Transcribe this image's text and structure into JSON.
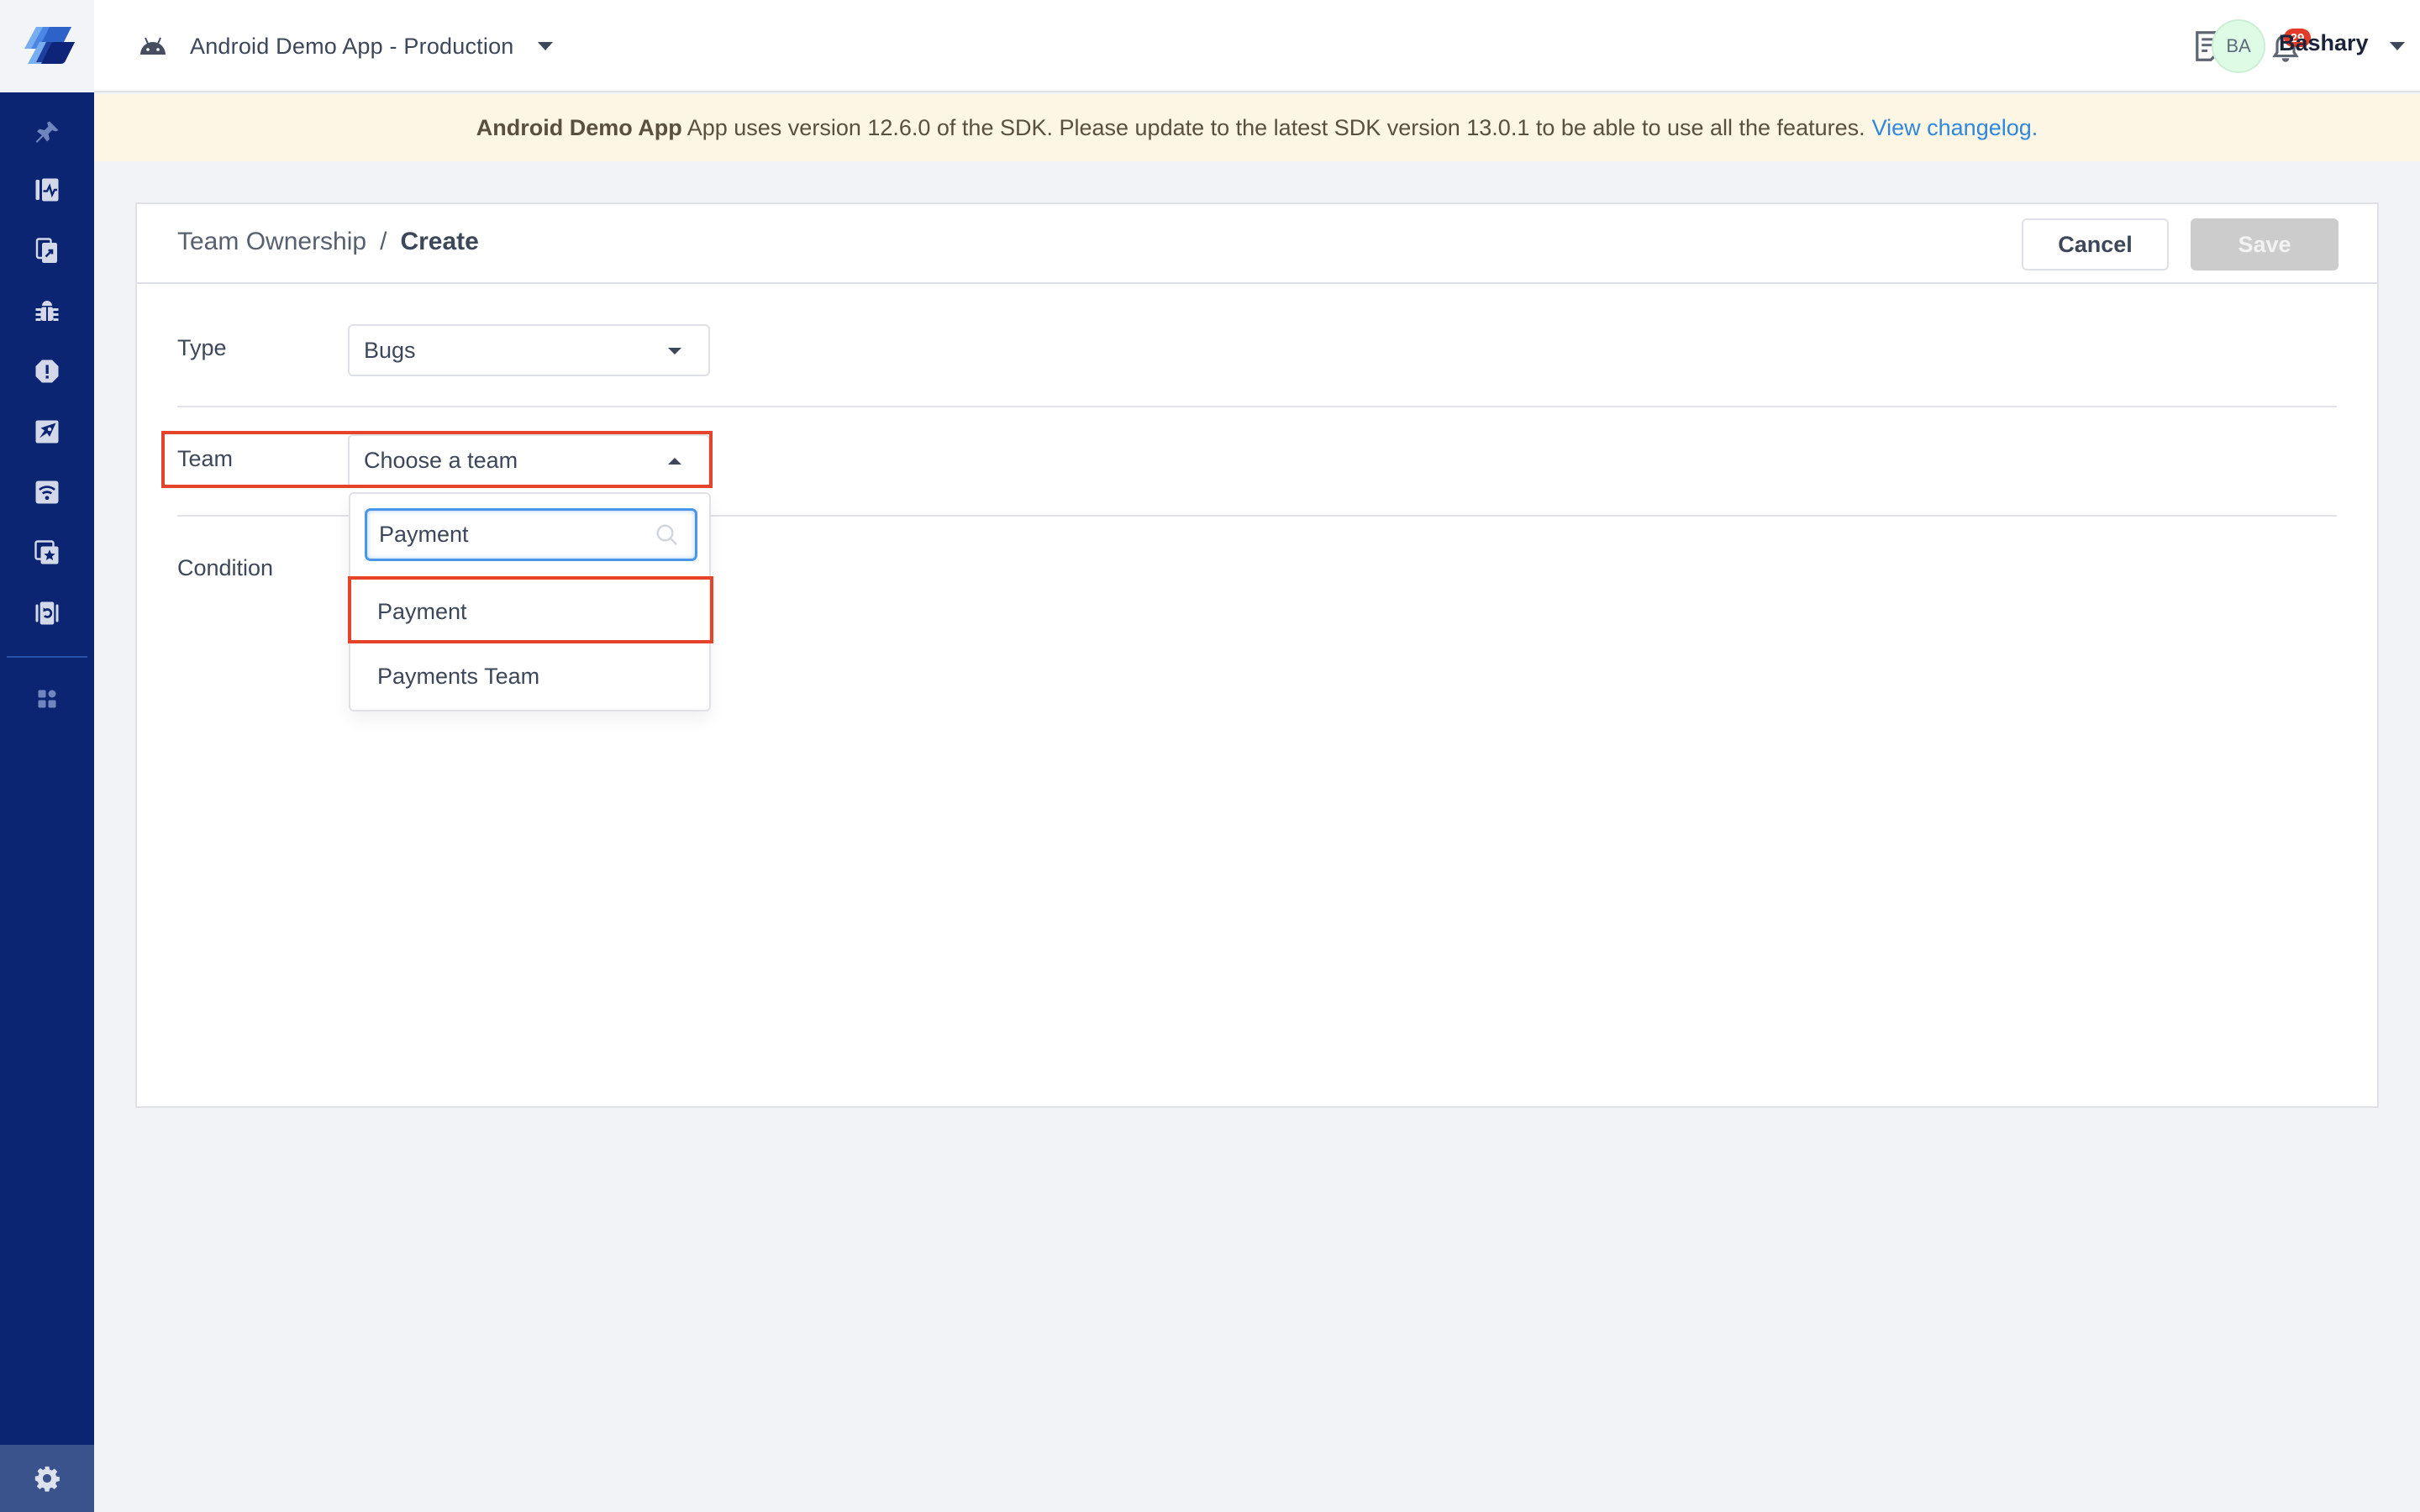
{
  "sidebar": {
    "logo": "instabug-logo-icon",
    "items": [
      {
        "name": "pin",
        "icon": "pin-icon"
      },
      {
        "name": "app-performance",
        "icon": "app-performance-icon"
      },
      {
        "name": "app-insights",
        "icon": "app-insights-icon"
      },
      {
        "name": "bugs",
        "icon": "bug-icon"
      },
      {
        "name": "crashes",
        "icon": "crash-icon"
      },
      {
        "name": "releases",
        "icon": "rocket-icon"
      },
      {
        "name": "network",
        "icon": "wifi-icon"
      },
      {
        "name": "ratings",
        "icon": "star-icon"
      },
      {
        "name": "replays",
        "icon": "replay-icon"
      },
      {
        "name": "apps",
        "icon": "apps-grid-icon"
      }
    ],
    "settings_icon": "gear-icon"
  },
  "topbar": {
    "app_name": "Android Demo App - Production",
    "platform_icon": "android-icon",
    "notifications_count": "29",
    "user_initials": "BA",
    "user_name": "Bashary"
  },
  "banner": {
    "app_bold": "Android Demo App",
    "message": " App uses version 12.6.0 of the SDK. Please update to the latest SDK version 13.0.1 to be able to use all the features.",
    "link_text": "View changelog."
  },
  "page": {
    "breadcrumb_parent": "Team Ownership",
    "breadcrumb_separator": "/",
    "breadcrumb_current": "Create",
    "cancel_label": "Cancel",
    "save_label": "Save"
  },
  "form": {
    "type_label": "Type",
    "type_value": "Bugs",
    "team_label": "Team",
    "team_placeholder": "Choose a team",
    "condition_label": "Condition",
    "team_search_value": "Payment",
    "team_options": [
      "Payment",
      "Payments Team"
    ]
  },
  "colors": {
    "sidebar": "#0c2572",
    "accent_blue": "#2f87de",
    "badge_red": "#e43a28",
    "highlight_red": "#e5432a",
    "banner_bg": "#fdf6e4"
  }
}
